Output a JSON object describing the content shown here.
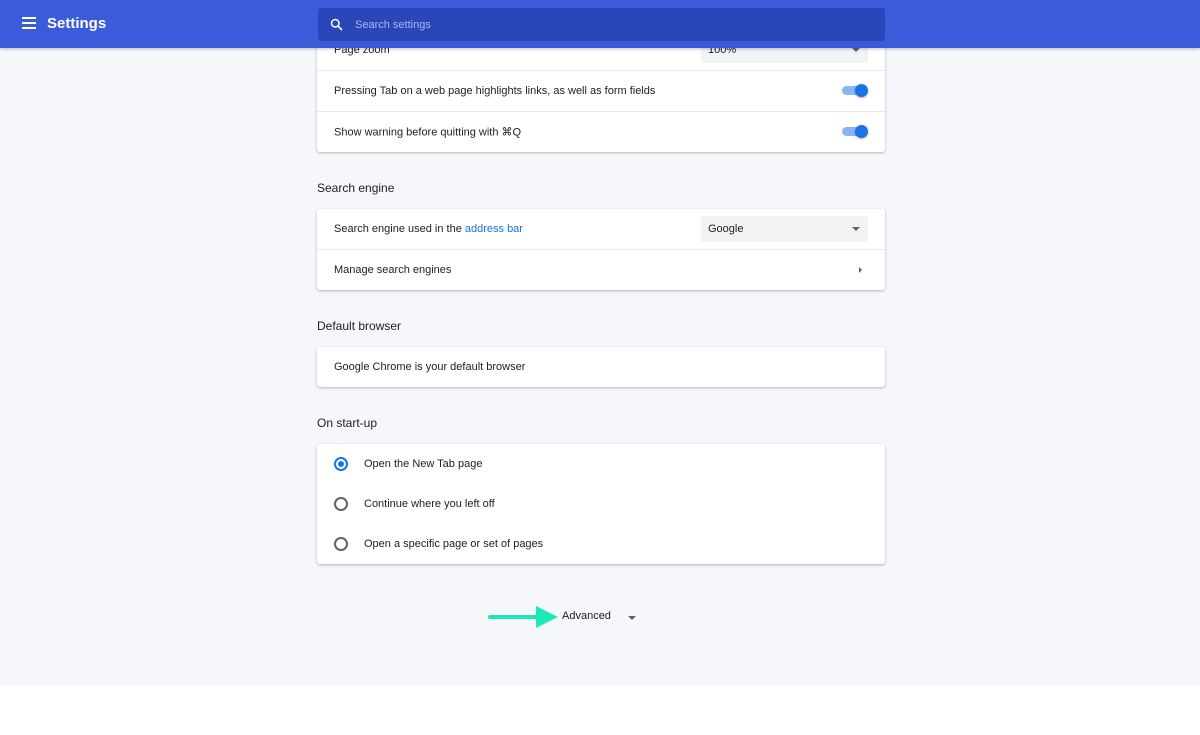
{
  "header": {
    "title": "Settings",
    "menu_icon": "hamburger-menu-icon",
    "search": {
      "placeholder": "Search settings",
      "value": "",
      "icon": "search-icon"
    },
    "color": "#3b5bdb"
  },
  "appearance": {
    "page_zoom": {
      "label": "Page zoom",
      "value": "100%"
    },
    "tab_highlight": {
      "label": "Pressing Tab on a web page highlights links, as well as form fields",
      "enabled": true
    },
    "quit_warning": {
      "label": "Show warning before quitting with ⌘Q",
      "enabled": true
    }
  },
  "search_engine": {
    "title": "Search engine",
    "used_label_prefix": "Search engine used in the ",
    "used_label_link": "address bar",
    "selected": "Google",
    "manage_label": "Manage search engines"
  },
  "default_browser": {
    "title": "Default browser",
    "status": "Google Chrome is your default browser"
  },
  "startup": {
    "title": "On start-up",
    "options": [
      {
        "label": "Open the New Tab page",
        "checked": true
      },
      {
        "label": "Continue where you left off",
        "checked": false
      },
      {
        "label": "Open a specific page or set of pages",
        "checked": false
      }
    ]
  },
  "advanced": {
    "label": "Advanced",
    "annotation_color": "#1de9b6"
  },
  "colors": {
    "accent": "#1a73e8",
    "background": "#f6f7fb"
  }
}
